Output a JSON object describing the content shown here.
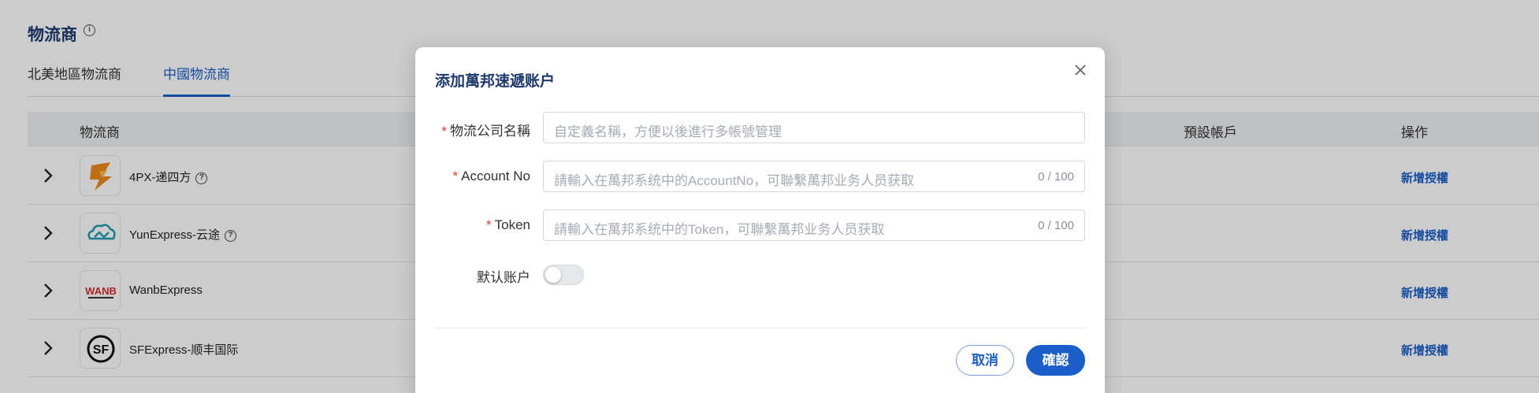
{
  "page": {
    "title": "物流商",
    "tabs": [
      {
        "label": "北美地區物流商",
        "active": false
      },
      {
        "label": "中國物流商",
        "active": true
      }
    ],
    "table": {
      "headers": [
        "物流商",
        "預設帳戶",
        "操作"
      ],
      "rows": [
        {
          "name": "4PX-递四方",
          "has_help": true,
          "action": "新增授權",
          "logo": "4px-logo"
        },
        {
          "name": "YunExpress-云途",
          "has_help": true,
          "action": "新增授權",
          "logo": "yunexpress-logo"
        },
        {
          "name": "WanbExpress",
          "has_help": false,
          "action": "新增授權",
          "logo": "wanb-logo"
        },
        {
          "name": "SFExpress-顺丰国际",
          "has_help": false,
          "action": "新增授權",
          "logo": "sf-logo"
        }
      ]
    }
  },
  "dialog": {
    "title": "添加萬邦速遞账户",
    "close_icon": "close-icon",
    "fields": {
      "company_name": {
        "label": "物流公司名稱",
        "required": true,
        "placeholder": "自定義名稱，方便以後進行多帳號管理",
        "value": ""
      },
      "account_no": {
        "label": "Account No",
        "required": true,
        "placeholder": "請輸入在萬邦系统中的AccountNo，可聯繫萬邦业务人员获取",
        "value": "",
        "counter": "0 / 100"
      },
      "token": {
        "label": "Token",
        "required": true,
        "placeholder": "請輸入在萬邦系统中的Token，可聯繫萬邦业务人员获取",
        "value": "",
        "counter": "0 / 100"
      },
      "default_account": {
        "label": "默认账户",
        "checked": false
      }
    },
    "buttons": {
      "cancel": "取消",
      "confirm": "確認"
    }
  },
  "colors": {
    "accent": "#1a5fc9",
    "title": "#1d3a6e",
    "required": "#e53935"
  }
}
